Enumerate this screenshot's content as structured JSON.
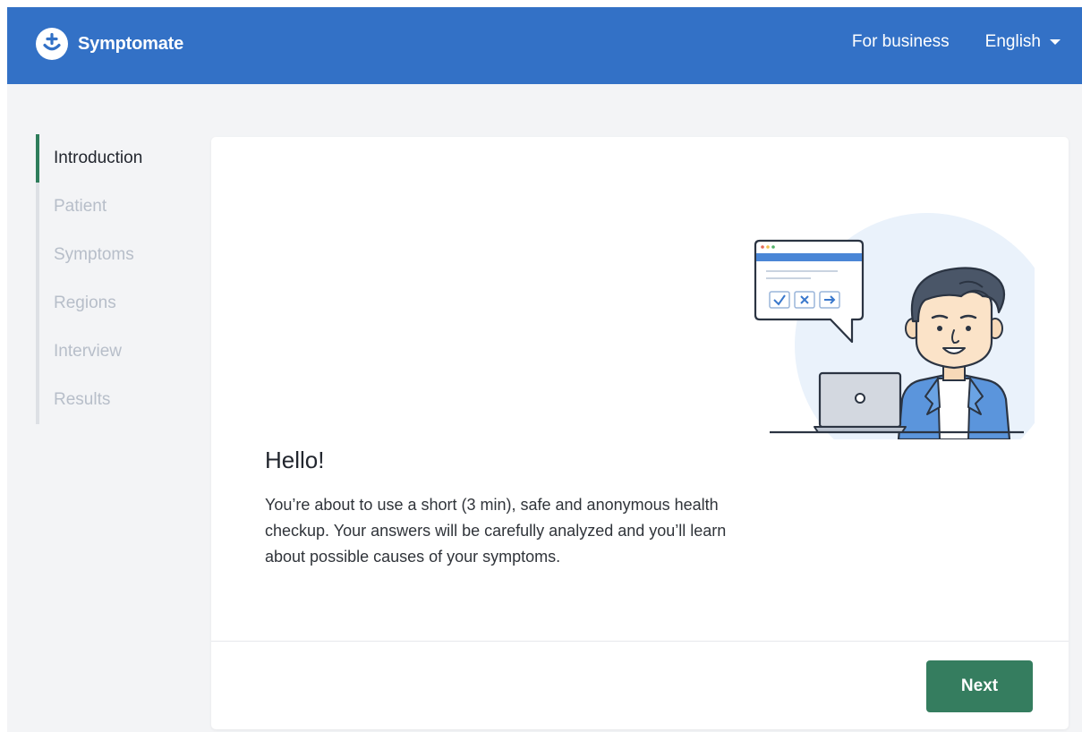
{
  "header": {
    "brand": "Symptomate",
    "for_business": "For business",
    "language": "English"
  },
  "steps": [
    {
      "label": "Introduction",
      "active": true
    },
    {
      "label": "Patient",
      "active": false
    },
    {
      "label": "Symptoms",
      "active": false
    },
    {
      "label": "Regions",
      "active": false
    },
    {
      "label": "Interview",
      "active": false
    },
    {
      "label": "Results",
      "active": false
    }
  ],
  "main": {
    "greeting": "Hello!",
    "intro": "You’re about to use a short (3 min), safe and anonymous health checkup. Your answers will be carefully analyzed and you’ll learn about possible causes of your symptoms.",
    "next_label": "Next"
  },
  "icons": {
    "logo": "plus-smile-logo-icon",
    "caret": "caret-down-icon"
  },
  "colors": {
    "header": "#3371c6",
    "accent": "#2e7d5b",
    "button": "#357d5f",
    "background": "#f3f4f6"
  }
}
